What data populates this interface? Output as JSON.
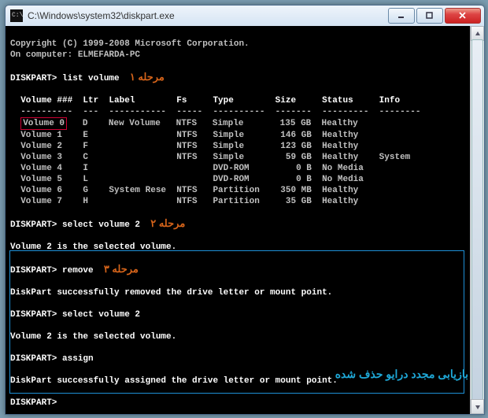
{
  "window": {
    "title": "C:\\Windows\\system32\\diskpart.exe"
  },
  "header": {
    "copyright": "Copyright (C) 1999-2008 Microsoft Corporation.",
    "computer": "On computer: ELMEFARDA-PC"
  },
  "prompts": {
    "p1": "DISKPART> list volume",
    "p2": "DISKPART> select volume 2",
    "p3": "DISKPART> remove",
    "p4": "DISKPART> select volume 2",
    "p5": "DISKPART> assign",
    "p6": "DISKPART>"
  },
  "annots": {
    "a1": "مرحله ۱",
    "a2": "مرحله ۲",
    "a3": "مرحله ۳",
    "a4": "بازیابی مجدد درایو حذف شده"
  },
  "table": {
    "hdr": {
      "col1": "Volume ###",
      "col2": "Ltr",
      "col3": "Label",
      "col4": "Fs",
      "col5": "Type",
      "col6": "Size",
      "col7": "Status",
      "col8": "Info"
    },
    "rows": [
      {
        "n": "0",
        "l": "D",
        "lab": "New Volume",
        "fs": "NTFS",
        "ty": "Simple",
        "sz": "135 GB",
        "st": "Healthy",
        "inf": ""
      },
      {
        "n": "1",
        "l": "E",
        "lab": "",
        "fs": "NTFS",
        "ty": "Simple",
        "sz": "146 GB",
        "st": "Healthy",
        "inf": ""
      },
      {
        "n": "2",
        "l": "F",
        "lab": "",
        "fs": "NTFS",
        "ty": "Simple",
        "sz": "123 GB",
        "st": "Healthy",
        "inf": ""
      },
      {
        "n": "3",
        "l": "C",
        "lab": "",
        "fs": "NTFS",
        "ty": "Simple",
        "sz": "59 GB",
        "st": "Healthy",
        "inf": "System"
      },
      {
        "n": "4",
        "l": "I",
        "lab": "",
        "fs": "",
        "ty": "DVD-ROM",
        "sz": "0 B",
        "st": "No Media",
        "inf": ""
      },
      {
        "n": "5",
        "l": "L",
        "lab": "",
        "fs": "",
        "ty": "DVD-ROM",
        "sz": "0 B",
        "st": "No Media",
        "inf": ""
      },
      {
        "n": "6",
        "l": "G",
        "lab": "System Rese",
        "fs": "NTFS",
        "ty": "Partition",
        "sz": "350 MB",
        "st": "Healthy",
        "inf": ""
      },
      {
        "n": "7",
        "l": "H",
        "lab": "",
        "fs": "NTFS",
        "ty": "Partition",
        "sz": "35 GB",
        "st": "Healthy",
        "inf": ""
      }
    ]
  },
  "msgs": {
    "m1": "Volume 2 is the selected volume.",
    "m2": "DiskPart successfully removed the drive letter or mount point.",
    "m3": "Volume 2 is the selected volume.",
    "m4": "DiskPart successfully assigned the drive letter or mount point."
  },
  "divider": "  ----------  ---  -----------  -----  ----------  -------  ---------  --------"
}
